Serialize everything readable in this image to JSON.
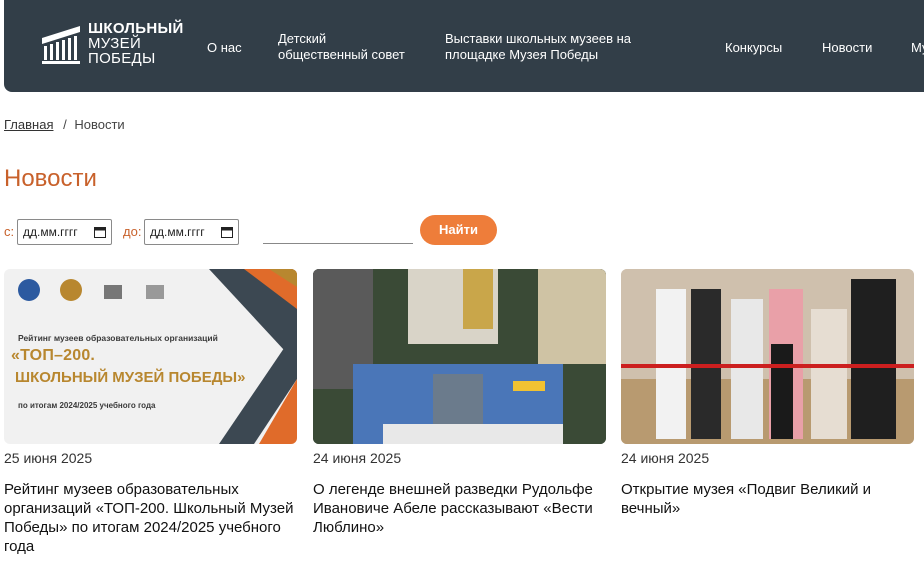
{
  "header": {
    "logo": {
      "line1": "ШКОЛЬНЫЙ",
      "line2": "МУЗЕЙ",
      "line3": "ПОБЕДЫ"
    },
    "nav": [
      {
        "label": "О нас"
      },
      {
        "label": "Детский общественный совет"
      },
      {
        "label": "Выставки школьных музеев на площадке Музея Победы"
      },
      {
        "label": "Конкурсы"
      },
      {
        "label": "Новости"
      },
      {
        "label": "Му"
      }
    ]
  },
  "breadcrumb": {
    "home": "Главная",
    "separator": "/",
    "current": "Новости"
  },
  "page": {
    "title": "Новости"
  },
  "filter": {
    "from_label": "с:",
    "to_label": "до:",
    "date_placeholder_from": "дд.мм.гггг",
    "date_placeholder_to": "дд.мм.гггг",
    "search_value": "",
    "submit_label": "Найти"
  },
  "news": [
    {
      "date": "25 июня 2025",
      "title": "Рейтинг музеев образовательных организаций «ТОП-200. Школьный Музей Победы» по итогам 2024/2025 учебного года",
      "image": {
        "subtitle": "Рейтинг музеев образовательных организаций",
        "headline1": "«ТОП–200.",
        "headline2": "ШКОЛЬНЫЙ МУЗЕЙ ПОБЕДЫ»",
        "footer": "по итогам 2024/2025 учебного года"
      }
    },
    {
      "date": "24 июня 2025",
      "title": "О легенде внешней разведки Рудольфе Ивановиче Абеле рассказывают «Вести Люблино»"
    },
    {
      "date": "24 июня 2025",
      "title": "Открытие музея «Подвиг Великий и вечный»"
    }
  ],
  "colors": {
    "header_bg": "#323e48",
    "accent": "#c8612b",
    "button": "#ee7d3a"
  }
}
